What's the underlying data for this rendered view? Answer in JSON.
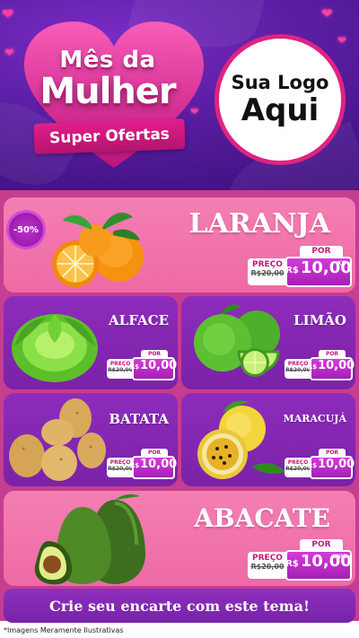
{
  "header": {
    "title_line1": "Mês da",
    "title_line2": "Mulher",
    "ribbon": "Super Ofertas",
    "logo_line1": "Sua Logo",
    "logo_line2": "Aqui"
  },
  "colors": {
    "header_purple": "#5b1ea3",
    "accent_pink": "#e0237f",
    "card_pink": "#f47fb3",
    "card_purple": "#8e2cbb",
    "price_purple": "#b52ac6"
  },
  "products": [
    {
      "name": "LARANJA",
      "badge": "-50%",
      "por": "POR",
      "preco": "PREÇO",
      "old_price": "R$20,00",
      "currency": "R$",
      "price": "10,00",
      "unit": "KG",
      "icon": "orange-icon"
    },
    {
      "name": "ALFACE",
      "por": "POR",
      "preco": "PREÇO",
      "old_price": "R$20,00",
      "currency": "R$",
      "price": "10,00",
      "icon": "lettuce-icon"
    },
    {
      "name": "LIMÃO",
      "por": "POR",
      "preco": "PREÇO",
      "old_price": "R$20,00",
      "currency": "R$",
      "price": "10,00",
      "icon": "lime-icon"
    },
    {
      "name": "BATATA",
      "por": "POR",
      "preco": "PREÇO",
      "old_price": "R$20,00",
      "currency": "R$",
      "price": "10,00",
      "icon": "potato-icon"
    },
    {
      "name": "MARACUJÁ",
      "por": "POR",
      "preco": "PREÇO",
      "old_price": "R$20,00",
      "currency": "R$",
      "price": "10,00",
      "icon": "passion-fruit-icon"
    },
    {
      "name": "ABACATE",
      "por": "POR",
      "preco": "PREÇO",
      "old_price": "R$20,00",
      "currency": "R$",
      "price": "10,00",
      "unit": "UNID.",
      "icon": "avocado-icon"
    }
  ],
  "cta": "Crie seu encarte com este tema!",
  "footer": "*Imagens Meramente Ilustrativas"
}
